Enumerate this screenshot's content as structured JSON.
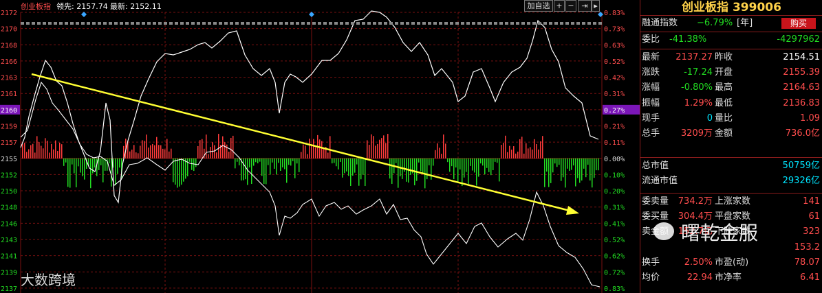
{
  "window": {
    "title": "创业板指",
    "lead_label": "领先: 2157.74",
    "latest_label": "最新: 2152.11",
    "btn_add": "加自选",
    "btn_plus": "+",
    "btn_minus": "−",
    "btn_arrow": "⇥",
    "btn_next": "▸"
  },
  "left_axis": [
    "2172",
    "2170",
    "2168",
    "2166",
    "2163",
    "2161",
    "2160",
    "2159",
    "2157",
    "2155",
    "2152",
    "2150",
    "2148",
    "2146",
    "2143",
    "2141",
    "2139",
    "2137"
  ],
  "right_axis": [
    "0.83%",
    "0.73%",
    "0.63%",
    "0.52%",
    "0.42%",
    "0.31%",
    "0.27%",
    "0.21%",
    "0.11%",
    "0.00%",
    "0.10%",
    "0.20%",
    "0.31%",
    "0.41%",
    "0.52%",
    "0.62%",
    "0.72%",
    "0.83%"
  ],
  "highlight": {
    "left": "2160",
    "right": "0.27%"
  },
  "panel": {
    "title": "创业板指 399006",
    "margin_label": "融通指数",
    "margin_value": "−6.79%",
    "margin_unit": "[年]",
    "buy_button": "购买",
    "weibi_label": "委比",
    "weibi_value": "-41.38%",
    "weicha_value": "-4297962",
    "rows": [
      {
        "l1": "最新",
        "v1": "2137.27",
        "l2": "昨收",
        "v2": "2154.51"
      },
      {
        "l1": "涨跌",
        "v1": "-17.24",
        "l2": "开盘",
        "v2": "2155.39"
      },
      {
        "l1": "涨幅",
        "v1": "-0.80%",
        "l2": "最高",
        "v2": "2164.63"
      },
      {
        "l1": "振幅",
        "v1": "1.29%",
        "l2": "最低",
        "v2": "2136.83"
      },
      {
        "l1": "现手",
        "v1": "0",
        "l2": "量比",
        "v2": "1.09"
      },
      {
        "l1": "总手",
        "v1": "3209万",
        "l2": "金额",
        "v2": "736.0亿"
      }
    ],
    "cap_rows": [
      {
        "label": "总市值",
        "value": "50759亿"
      },
      {
        "label": "流通市值",
        "value": "29326亿"
      }
    ],
    "book_rows": [
      {
        "l1": "委卖量",
        "v1": "734.2万",
        "l2": "上涨家数",
        "v2": "141"
      },
      {
        "l1": "委买量",
        "v1": "304.4万",
        "l2": "平盘家数",
        "v2": "61"
      },
      {
        "l1": "卖金额",
        "v1": "152.7亿",
        "l2": "下跌家数",
        "v2": "323"
      },
      {
        "l1": "",
        "v1": "",
        "l2": "",
        "v2": "153.2"
      },
      {
        "l1": "换手",
        "v1": "2.50%",
        "l2": "市盈(动)",
        "v2": "78.07"
      },
      {
        "l1": "均价",
        "v1": "22.94",
        "l2": "市净率",
        "v2": "6.41"
      }
    ]
  },
  "watermarks": {
    "left": "大数跨境",
    "right": "曙乾金服"
  },
  "colors": {
    "up": "#ff3b3b",
    "down": "#22dd22",
    "price": "#ffffff",
    "trend": "#ffff33",
    "grid": "#7a1010",
    "yellow": "#ffd24a",
    "cyan": "#00e5ff"
  }
}
